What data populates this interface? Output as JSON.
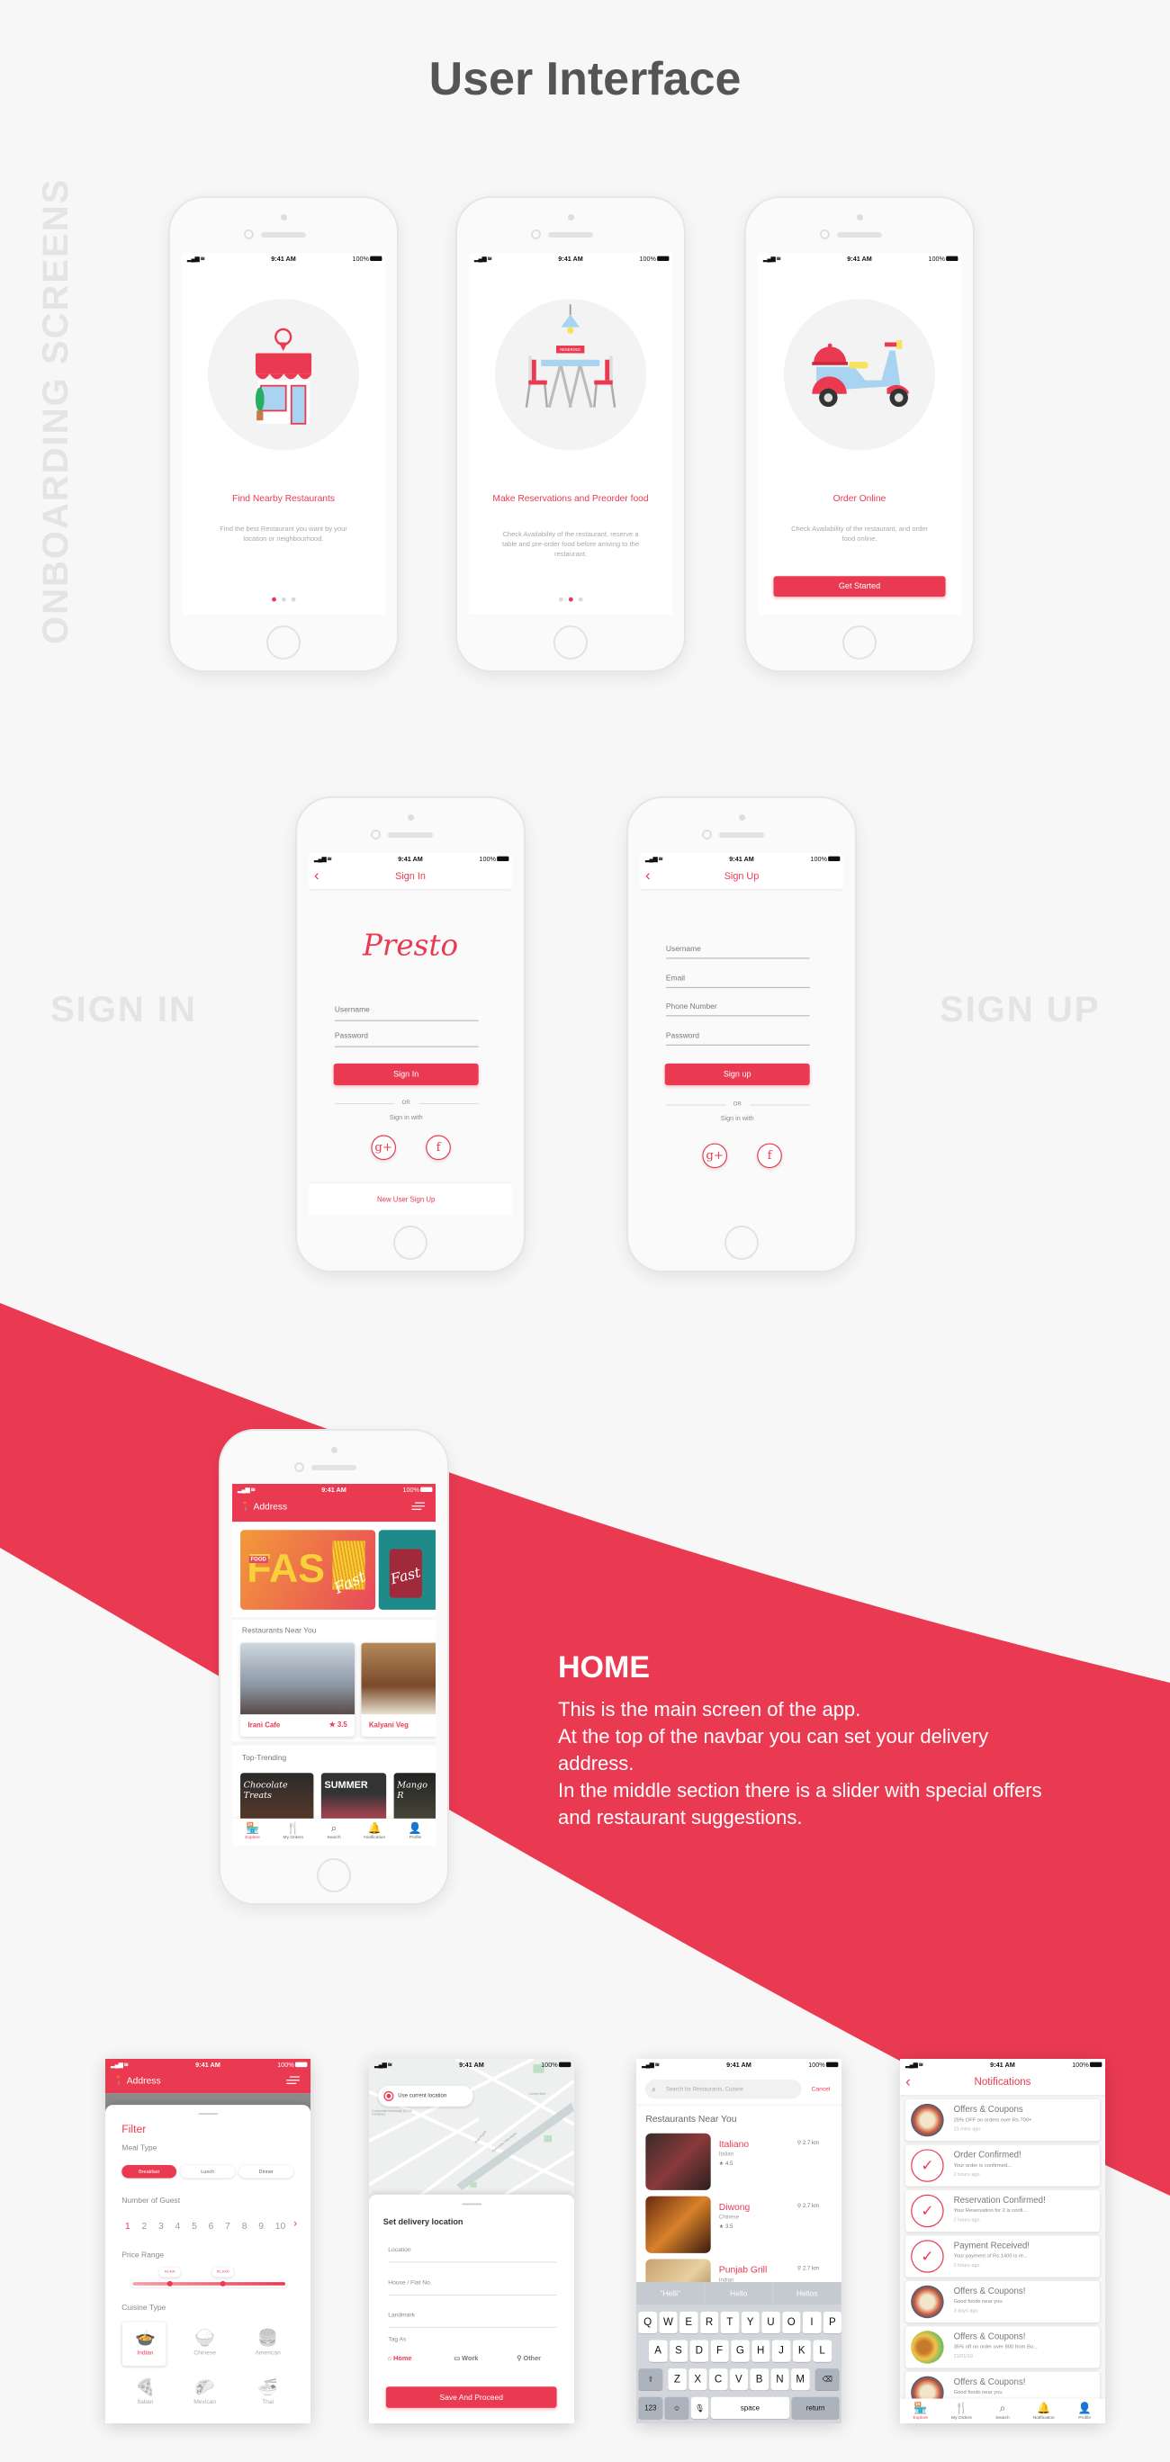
{
  "page": {
    "title": "User Interface"
  },
  "sections": {
    "onboarding": "ONBOARDING SCREENS",
    "sign_in": "SIGN IN",
    "sign_up": "SIGN UP"
  },
  "colors": {
    "accent": "#ea3a52",
    "background": "#f7f7f7"
  },
  "status_bar": {
    "time": "9:41 AM",
    "battery": "100%"
  },
  "onboarding": {
    "screens": [
      {
        "title": "Find Nearby Restaurants",
        "description": "Find the best Restaurant you want by your location or neighbourhood.",
        "illustration": "storefront",
        "active_dot": 1
      },
      {
        "title": "Make Reservations and Preorder food",
        "description": "Check Availability of the restaurant, reserve a table and pre-order food before arriving to the restaurant.",
        "illustration": "reserved-table",
        "active_dot": 2,
        "sign_text": "RESERVED"
      },
      {
        "title": "Order Online",
        "description": "Check Availability of the restaurant, and order food online.",
        "illustration": "delivery-scooter"
      }
    ],
    "get_started": "Get Started"
  },
  "sign_in": {
    "header": "Sign In",
    "logo": "Presto",
    "username": "Username",
    "password": "Password",
    "button": "Sign In",
    "or": "OR",
    "sign_in_with": "Sign in with",
    "google": "g+",
    "facebook": "f",
    "footer_link": "New User Sign Up"
  },
  "sign_up": {
    "header": "Sign Up",
    "fields": [
      "Username",
      "Email",
      "Phone Number",
      "Password"
    ],
    "button": "Sign up",
    "or": "OR",
    "sign_in_with": "Sign in with"
  },
  "home": {
    "address": "Address",
    "banners": [
      {
        "small": "FOOD",
        "big": "FAS",
        "script": "Fast"
      },
      {
        "script": "Fast"
      }
    ],
    "near_title": "Restaurants Near You",
    "restaurants": [
      {
        "name": "Irani Cafe",
        "rating": "3.5"
      },
      {
        "name": "Kalyani Veg"
      }
    ],
    "trending_title": "Top-Trending",
    "trending": [
      "Chocolate Treats",
      "SUMMER",
      "Mango R"
    ]
  },
  "bottom_nav": [
    {
      "label": "Explore",
      "icon": "storefront-icon",
      "active": true
    },
    {
      "label": "My Orders",
      "icon": "cutlery-icon"
    },
    {
      "label": "Search",
      "icon": "search-icon"
    },
    {
      "label": "Notification",
      "icon": "bell-icon"
    },
    {
      "label": "Profile",
      "icon": "user-icon"
    }
  ],
  "home_description": {
    "heading": "HOME",
    "lines": [
      "This is the main screen of the app.",
      "At the top of the navbar you can set your delivery address.",
      "In the middle section there is a slider with special offers and restaurant suggestions."
    ]
  },
  "filter": {
    "address": "Address",
    "title": "Filter",
    "meal_type_label": "Meal Type",
    "meal_types": [
      "Breakfast",
      "Lunch",
      "Dinner"
    ],
    "selected_meal": "Breakfast",
    "guest_label": "Number of Guest",
    "guests": [
      "1",
      "2",
      "3",
      "4",
      "5",
      "6",
      "7",
      "8",
      "9",
      "10"
    ],
    "selected_guest": "1",
    "price_label": "Price Range",
    "price_min": "Rs.400",
    "price_max": "Rs.1000",
    "cuisine_label": "Cuisine Type",
    "cuisines": [
      {
        "label": "Indian",
        "icon": "curry-bowl-icon",
        "glyph": "🍲"
      },
      {
        "label": "Chinese",
        "icon": "rice-bowl-icon",
        "glyph": "🍚"
      },
      {
        "label": "American",
        "icon": "burger-icon",
        "glyph": "🍔"
      },
      {
        "label": "Italian",
        "icon": "pizza-icon",
        "glyph": "🍕"
      },
      {
        "label": "Mexican",
        "icon": "taco-icon",
        "glyph": "🌮"
      },
      {
        "label": "Thai",
        "icon": "noodle-bowl-icon",
        "glyph": "🍜"
      }
    ],
    "selected_cuisine": "Indian"
  },
  "delivery": {
    "use_current_location": "Use current location",
    "map_labels": [
      "Concordia University (SGW Campus)",
      "Centre Bell",
      "Rue Argyle",
      "Autoroute Ville-Marie"
    ],
    "title": "Set delivery location",
    "fields": [
      "Location",
      "House / Flat No.",
      "Landmark"
    ],
    "tag_label": "Tag As",
    "tags": [
      {
        "label": "Home",
        "icon": "home-icon"
      },
      {
        "label": "Work",
        "icon": "briefcase-icon"
      },
      {
        "label": "Other",
        "icon": "location-pin-icon"
      }
    ],
    "selected_tag": "Home",
    "button": "Save And Proceed"
  },
  "search": {
    "placeholder": "Search for Restaurants, Cuisine",
    "cancel": "Cancel",
    "section_title": "Restaurants Near You",
    "results": [
      {
        "name": "Italiano",
        "cuisine": "Italian",
        "rating": "4.5",
        "distance": "2.7 km"
      },
      {
        "name": "Diwong",
        "cuisine": "Chinese",
        "rating": "3.5",
        "distance": "2.7 km"
      },
      {
        "name": "Punjab Grill",
        "cuisine": "Indian",
        "distance": "2.7 km"
      }
    ],
    "keyboard": {
      "suggestions": [
        "\"Helli\"",
        "Hello",
        "Hellos"
      ],
      "rows": [
        [
          "Q",
          "W",
          "E",
          "R",
          "T",
          "Y",
          "U",
          "O",
          "I",
          "P"
        ],
        [
          "A",
          "S",
          "D",
          "F",
          "G",
          "H",
          "J",
          "K",
          "L"
        ],
        [
          "Z",
          "X",
          "C",
          "V",
          "B",
          "N",
          "M"
        ]
      ],
      "numbers": "123",
      "space": "space",
      "return": "return"
    }
  },
  "notifications": {
    "title": "Notifications",
    "items": [
      {
        "title": "Offers & Coupons",
        "subtitle": "25% OFF on orders over Rs.700+",
        "time": "23 mins ago",
        "icon": "offer"
      },
      {
        "title": "Order Confirmed!",
        "subtitle": "Your order is confirmed...",
        "time": "2 hours ago",
        "icon": "check"
      },
      {
        "title": "Reservation Confirmed!",
        "subtitle": "Your Reservation for 2 is confi...",
        "time": "2 hours ago",
        "icon": "check"
      },
      {
        "title": "Payment Received!",
        "subtitle": "Your payment of Rs.1400 is re...",
        "time": "2 hours ago",
        "icon": "check"
      },
      {
        "title": "Offers & Coupons!",
        "subtitle": "Good foods near you",
        "time": "3 days ago",
        "icon": "offer"
      },
      {
        "title": "Offers & Coupons!",
        "subtitle": "35% off on order over 800 from Bu...",
        "time": "21/01/19",
        "icon": "burger"
      },
      {
        "title": "Offers & Coupons!",
        "subtitle": "Good foods near you",
        "icon": "offer"
      }
    ]
  }
}
